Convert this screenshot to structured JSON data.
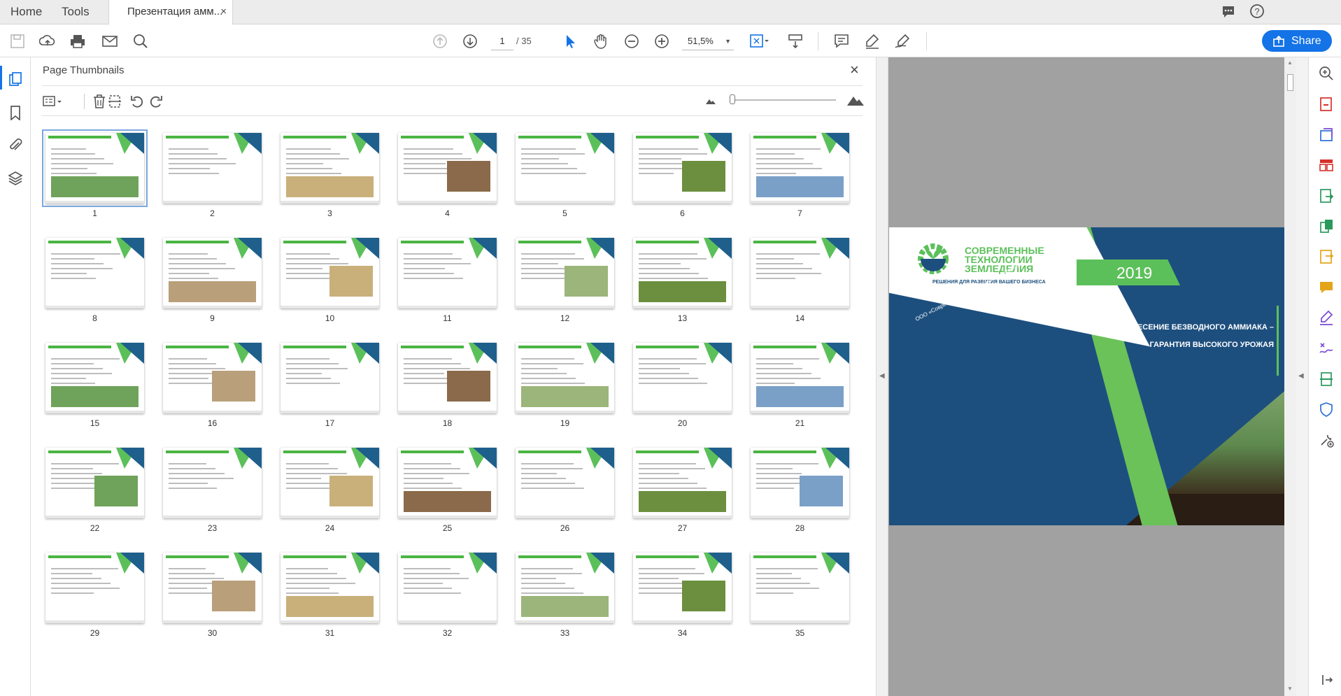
{
  "tabs": {
    "home": "Home",
    "tools": "Tools",
    "document": "Презентация амм...",
    "close": "×"
  },
  "toolbar": {
    "current_page": "1",
    "total_pages": "/ 35",
    "zoom": "51,5%",
    "share_label": "Share"
  },
  "panel": {
    "title": "Page Thumbnails",
    "close": "×"
  },
  "thumbnails": [
    "1",
    "2",
    "3",
    "4",
    "5",
    "6",
    "7",
    "8",
    "9",
    "10",
    "11",
    "12",
    "13",
    "14",
    "15",
    "16",
    "17",
    "18",
    "19",
    "20",
    "21",
    "22",
    "23",
    "24",
    "25",
    "26",
    "27",
    "28",
    "29",
    "30",
    "31",
    "32",
    "33",
    "34",
    "35"
  ],
  "slide": {
    "logo_text": "СОВРЕМЕННЫЕ ТЕХНОЛОГИИ ЗЕМЛЕДЕЛИЯ",
    "logo_sub": "РЕШЕНИЯ ДЛЯ РАЗВИТИЯ ВАШЕГО БИЗНЕСА",
    "year": "2019",
    "headline": "ВНЕСЕНИЕ БЕЗВОДНОГО АММИАКА – ГАРАНТИЯ ВЫСОКОГО УРОЖАЯ",
    "company": "ООО «Современные технологии земледелия»"
  },
  "colors": {
    "accent": "#1473e6",
    "brand_green": "#5cc05a",
    "brand_navy": "#1d4f7e"
  },
  "icons": {
    "toolbar": [
      "save-icon",
      "upload-icon",
      "print-icon",
      "email-icon",
      "find-icon",
      "page-up-icon",
      "page-down-icon",
      "select-cursor-icon",
      "hand-tool-icon",
      "zoom-out-icon",
      "zoom-in-icon",
      "fit-page-icon",
      "scroll-mode-icon",
      "comment-icon",
      "highlight-icon",
      "sign-icon"
    ],
    "left_rail": [
      "page-thumbnails-icon",
      "bookmark-icon",
      "attachment-icon",
      "layers-icon"
    ],
    "right_rail": [
      "search-zoom-icon",
      "export-pdf-icon",
      "create-pdf-icon",
      "organize-pages-icon",
      "edit-pdf-icon",
      "combine-files-icon",
      "export-icon",
      "comment-tool-icon",
      "fill-sign-icon",
      "request-signature-icon",
      "scan-icon",
      "protect-icon",
      "more-tools-icon",
      "collapse-panel-icon"
    ]
  }
}
